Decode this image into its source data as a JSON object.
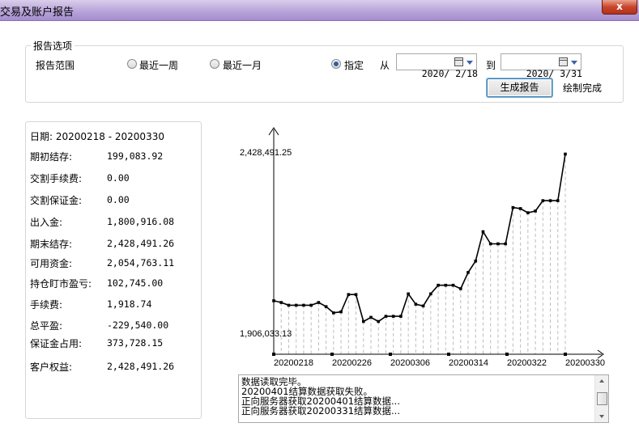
{
  "window": {
    "title": "交易及账户报告",
    "close_label": "x"
  },
  "options": {
    "group_title": "报告选项",
    "range_label": "报告范围",
    "radio_week": "最近一周",
    "radio_month": "最近一月",
    "radio_custom": "指定",
    "selected": "指定",
    "from_label": "从",
    "from_date": "2020/ 2/18",
    "to_label": "到",
    "to_date": "2020/ 3/31",
    "generate_button": "生成报告",
    "status": "绘制完成"
  },
  "info": {
    "date_line": "日期: 20200218 - 20200330",
    "rows": [
      {
        "label": "期初结存:",
        "value": "199,083.92"
      },
      {
        "label": "交割手续费:",
        "value": "0.00"
      },
      {
        "label": "交割保证金:",
        "value": "0.00"
      },
      {
        "label": "出入金:",
        "value": "1,800,916.08"
      },
      {
        "label": "期末结存:",
        "value": "2,428,491.26"
      },
      {
        "label": "可用资金:",
        "value": "2,054,763.11"
      },
      {
        "label": "持仓盯市盈亏:",
        "value": "102,745.00"
      },
      {
        "label": "手续费:",
        "value": "1,918.74"
      },
      {
        "label": "总平盈:",
        "value": "-229,540.00"
      },
      {
        "label": "保证金占用:",
        "value": "373,728.15"
      },
      {
        "label": "客户权益:",
        "value": "2,428,491.26"
      }
    ]
  },
  "chart_data": {
    "type": "line",
    "y_max_label": "2,428,491.25",
    "y_min_label": "1,906,033.13",
    "ylim": [
      1906033.13,
      2428491.25
    ],
    "x_tick_labels": [
      "20200218",
      "20200226",
      "20200306",
      "20200314",
      "20200322",
      "20200330"
    ],
    "values": [
      2000000,
      1995000,
      1987000,
      1987000,
      1987000,
      1987000,
      1995000,
      1983000,
      1965000,
      1968000,
      2018000,
      2018000,
      1940000,
      1952000,
      1940000,
      1955000,
      1955000,
      1955000,
      2020000,
      1990000,
      1985000,
      2020000,
      2045000,
      2045000,
      2045000,
      2035000,
      2082000,
      2115000,
      2200000,
      2165000,
      2165000,
      2165000,
      2270000,
      2267000,
      2255000,
      2260000,
      2290000,
      2290000,
      2290000,
      2425000
    ],
    "line_color": "#000000",
    "grid": "dashed vertical drop lines"
  },
  "log": {
    "lines": [
      "数据读取完毕。",
      "20200401结算数据获取失败。",
      "正向服务器获取20200401结算数据...",
      "正向服务器获取20200331结算数据..."
    ]
  }
}
